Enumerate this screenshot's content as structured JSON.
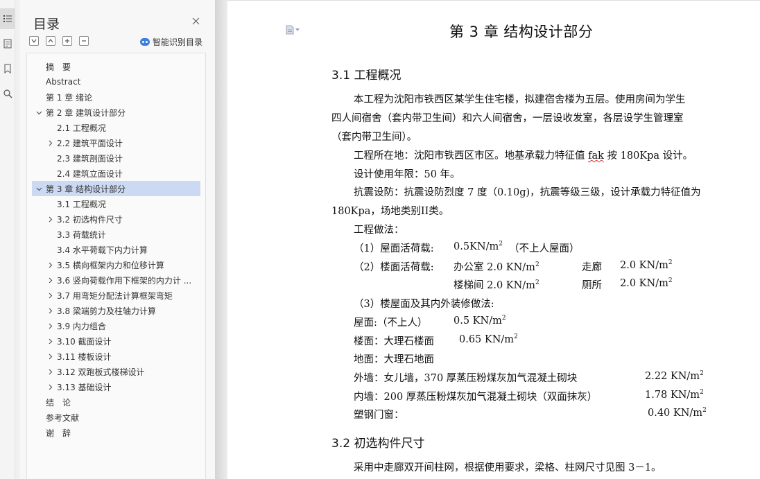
{
  "toc": {
    "title": "目录",
    "smart_label": "智能识别目录",
    "items": [
      {
        "label": "摘　要",
        "level": 1,
        "arrow": "none",
        "selected": false
      },
      {
        "label": "Abstract",
        "level": 1,
        "arrow": "none",
        "selected": false
      },
      {
        "label": "第 1 章  绪论",
        "level": 1,
        "arrow": "none",
        "selected": false
      },
      {
        "label": "第 2 章  建筑设计部分",
        "level": 1,
        "arrow": "down",
        "selected": false
      },
      {
        "label": "2.1 工程概况",
        "level": 2,
        "arrow": "none",
        "selected": false
      },
      {
        "label": "2.2 建筑平面设计",
        "level": 2,
        "arrow": "right",
        "selected": false
      },
      {
        "label": "2.3 建筑剖面设计",
        "level": 2,
        "arrow": "none",
        "selected": false
      },
      {
        "label": "2.4 建筑立面设计",
        "level": 2,
        "arrow": "none",
        "selected": false
      },
      {
        "label": "第 3 章  结构设计部分",
        "level": 1,
        "arrow": "down",
        "selected": true
      },
      {
        "label": "3.1 工程概况",
        "level": 2,
        "arrow": "none",
        "selected": false
      },
      {
        "label": "3.2  初选构件尺寸",
        "level": 2,
        "arrow": "right",
        "selected": false
      },
      {
        "label": "3.3 荷载统计",
        "level": 2,
        "arrow": "none",
        "selected": false
      },
      {
        "label": "3.4  水平荷载下内力计算",
        "level": 2,
        "arrow": "none",
        "selected": false
      },
      {
        "label": "3.5 横向框架内力和位移计算",
        "level": 2,
        "arrow": "right",
        "selected": false
      },
      {
        "label": "3.6 竖向荷载作用下框架的内力计 ...",
        "level": 2,
        "arrow": "right",
        "selected": false
      },
      {
        "label": "3.7 用弯矩分配法计算框架弯矩",
        "level": 2,
        "arrow": "right",
        "selected": false
      },
      {
        "label": "3.8  梁端剪力及柱轴力计算",
        "level": 2,
        "arrow": "right",
        "selected": false
      },
      {
        "label": "3.9  内力组合",
        "level": 2,
        "arrow": "right",
        "selected": false
      },
      {
        "label": "3.10 截面设计",
        "level": 2,
        "arrow": "right",
        "selected": false
      },
      {
        "label": "3.11 楼板设计",
        "level": 2,
        "arrow": "right",
        "selected": false
      },
      {
        "label": "3.12 双跑板式楼梯设计",
        "level": 2,
        "arrow": "right",
        "selected": false
      },
      {
        "label": "3.13 基础设计",
        "level": 2,
        "arrow": "right",
        "selected": false
      },
      {
        "label": "结　论",
        "level": 1,
        "arrow": "none",
        "selected": false
      },
      {
        "label": "参考文献",
        "level": 1,
        "arrow": "none",
        "selected": false
      },
      {
        "label": "谢　辞",
        "level": 1,
        "arrow": "none",
        "selected": false
      }
    ]
  },
  "rail_icons": [
    "toc-icon",
    "outline-icon",
    "bookmark-icon",
    "find-icon"
  ],
  "document": {
    "chapter_title": "第 3 章  结构设计部分",
    "section_1": "3.1 工程概况",
    "p1_l1": "本工程为沈阳市铁西区某学生住宅楼，拟建宿舍楼为五层。使用房间为学生",
    "p1_l2": "四人间宿舍（套内带卫生间）和六人间宿舍，一层设收发室，各层设学生管理室",
    "p1_l3": "（套内带卫生间）。",
    "p2_a": "工程所在地：沈阳市铁西区市区。地基承载力特征值 ",
    "p2_fak": "fak",
    "p2_b": " 按 180Kpa  设计。",
    "p3": "设计使用年限：50 年。",
    "p4_l1": "抗震设防：抗震设防烈度 7 度（0.10g)，抗震等级三级，设计承载力特征值为",
    "p4_l2": "180Kpa，场地类别II类。",
    "p5": "工程做法：",
    "roof_live_label": "（1）屋面活荷载:",
    "roof_live_value": "0.5KN/m",
    "roof_live_note": "（不上人屋面）",
    "floor_live_label": "（2）楼面活荷载:",
    "office_value": "办公室 2.0 KN/m",
    "corridor_label": "走廊",
    "corridor_value": "2.0 KN/m",
    "stair_value": "楼梯间 2.0 KN/m",
    "toilet_label": "厕所",
    "toilet_value": "2.0 KN/m",
    "finish_label": "（3）楼屋面及其内外装修做法:",
    "roof_label": "屋面:（不上人）",
    "roof_value": "0.5 KN/m",
    "floor_label": "楼面：大理石楼面",
    "floor_value": "0.65 KN/m",
    "ground_label": "地面：大理石地面",
    "ext_wall_label": "外墙：女儿墙，370 厚蒸压粉煤灰加气混凝土砌块",
    "ext_wall_value": "2.22 KN/m",
    "int_wall_label": "内墙：200 厚蒸压粉煤灰加气混凝土砌块（双面抹灰）",
    "int_wall_value": "1.78 KN/m",
    "window_label": "塑钢门窗：",
    "window_value": "0.40 KN/m",
    "sup2": "2",
    "section_2": "3.2  初选构件尺寸",
    "p_last": "采用中走廊双开间柱网，根据使用要求，梁格、柱网尺寸见图 3－1。"
  }
}
